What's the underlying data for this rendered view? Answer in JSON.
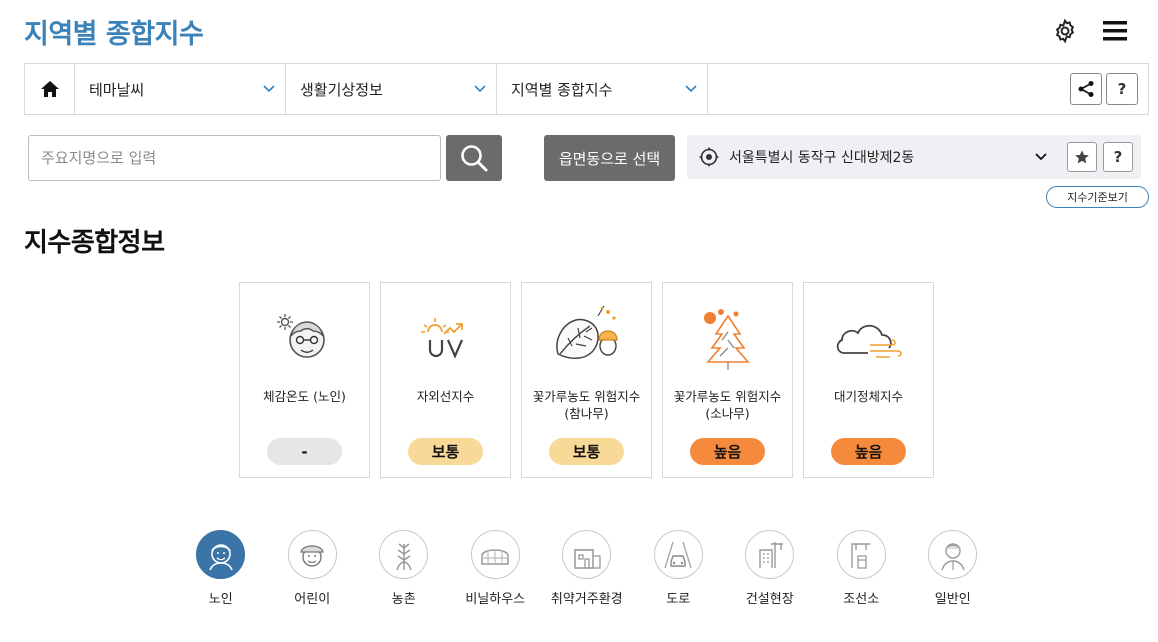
{
  "page": {
    "title": "지역별 종합지수"
  },
  "top_icons": {
    "settings": "gear-icon",
    "menu": "hamburger-icon"
  },
  "navbar": {
    "home_icon": "home-icon",
    "selects": [
      {
        "label": "테마날씨"
      },
      {
        "label": "생활기상정보"
      },
      {
        "label": "지역별 종합지수"
      }
    ],
    "share_icon": "share-icon",
    "help_label": "?"
  },
  "search": {
    "placeholder": "주요지명으로 입력",
    "value": ""
  },
  "dong_button": {
    "label": "읍면동으로 선택"
  },
  "location": {
    "text": "서울특별시 동작구 신대방제2동",
    "help_label": "?"
  },
  "standard_button": {
    "label": "지수기준보기"
  },
  "section": {
    "title": "지수종합정보"
  },
  "cards": [
    {
      "name": "체감온도 (노인)",
      "level": "-",
      "color": "#e6e6e6",
      "icon": "elderly-sun-icon"
    },
    {
      "name": "자외선지수",
      "level": "보통",
      "color": "#f8d997",
      "icon": "uv-icon"
    },
    {
      "name": "꽃가루농도 위험지수\n(참나무)",
      "level": "보통",
      "color": "#f8d997",
      "icon": "oak-leaf-icon"
    },
    {
      "name": "꽃가루농도 위험지수\n(소나무)",
      "level": "높음",
      "color": "#f58a3c",
      "icon": "pine-tree-icon"
    },
    {
      "name": "대기정체지수",
      "level": "높음",
      "color": "#f58a3c",
      "icon": "cloud-wind-icon"
    }
  ],
  "targets": [
    {
      "label": "노인",
      "active": true,
      "icon": "elderly-icon"
    },
    {
      "label": "어린이",
      "active": false,
      "icon": "child-icon"
    },
    {
      "label": "농촌",
      "active": false,
      "icon": "wheat-icon"
    },
    {
      "label": "비닐하우스",
      "active": false,
      "icon": "greenhouse-icon"
    },
    {
      "label": "취약거주환경",
      "active": false,
      "icon": "house-icon"
    },
    {
      "label": "도로",
      "active": false,
      "icon": "road-car-icon"
    },
    {
      "label": "건설현장",
      "active": false,
      "icon": "construction-icon"
    },
    {
      "label": "조선소",
      "active": false,
      "icon": "shipyard-icon"
    },
    {
      "label": "일반인",
      "active": false,
      "icon": "person-icon"
    }
  ]
}
